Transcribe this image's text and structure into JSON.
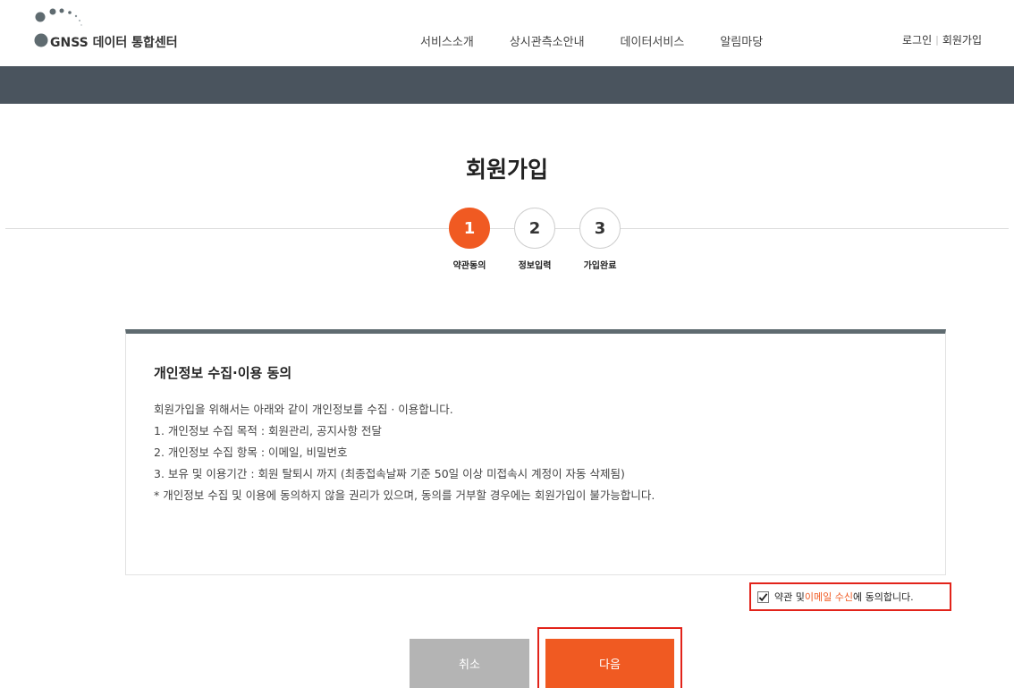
{
  "header": {
    "logo_text": "GNSS 데이터 통합센터",
    "nav": [
      "서비스소개",
      "상시관측소안내",
      "데이터서비스",
      "알림마당"
    ],
    "login": "로그인",
    "separator": "|",
    "signup": "회원가입"
  },
  "page": {
    "title": "회원가입",
    "steps": [
      {
        "number": "1",
        "label": "약관동의"
      },
      {
        "number": "2",
        "label": "정보입력"
      },
      {
        "number": "3",
        "label": "가입완료"
      }
    ],
    "active_step": 1
  },
  "terms": {
    "title": "개인정보 수집·이용 동의",
    "lines": [
      "회원가입을 위해서는 아래와 같이 개인정보를 수집 · 이용합니다.",
      "1. 개인정보 수집 목적 : 회원관리, 공지사항 전달",
      "2. 개인정보 수집 항목 : 이메일, 비밀번호",
      "3. 보유 및 이용기간 : 회원 탈퇴시 까지 (최종접속날짜 기준 50일 이상 미접속시 계정이 자동 삭제됨)",
      "* 개인정보 수집 및 이용에 동의하지 않을 권리가 있으며, 동의를 거부할 경우에는 회원가입이 불가능합니다."
    ]
  },
  "agree": {
    "checked": true,
    "text_pre": "약관 및 ",
    "text_highlight": "이메일 수신",
    "text_post": "에 동의합니다."
  },
  "buttons": {
    "cancel_label": "취소",
    "next_label": "다음"
  },
  "colors": {
    "accent": "#f05a22",
    "banner": "#4a545e",
    "highlight_border": "#e2231a"
  }
}
